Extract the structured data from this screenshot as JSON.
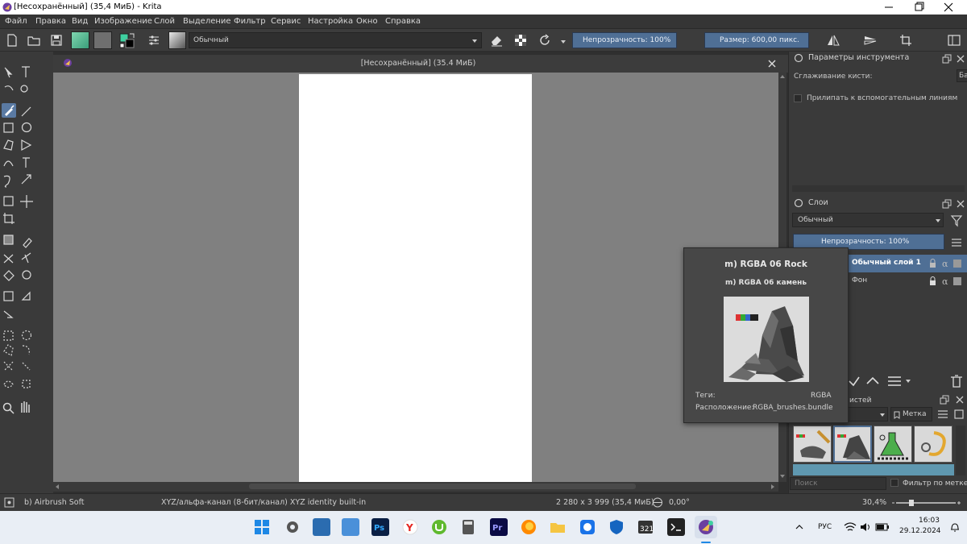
{
  "window": {
    "title": "[Несохранённый]  (35,4 МиБ)  - Krita"
  },
  "menu": [
    "Файл",
    "Правка",
    "Вид",
    "Изображение",
    "Слой",
    "Выделение",
    "Фильтр",
    "Сервис",
    "Настройка",
    "Окно",
    "Справка"
  ],
  "toolbar": {
    "blend_mode": "Обычный",
    "opacity_label": "Непрозрачность: 100%",
    "size_label": "Размер: 600,00 пикс."
  },
  "document": {
    "tab_title": "[Несохранённый]  (35.4 МиБ)"
  },
  "tool_options": {
    "header": "Параметры инструмента",
    "smoothing_label": "Сглаживание кисти:",
    "smoothing_value": "Ба",
    "snap_label": "Прилипать к вспомогательным линиям"
  },
  "layers": {
    "header": "Слои",
    "blend_mode": "Обычный",
    "opacity_label": "Непрозрачность:  100%",
    "items": [
      {
        "name": "Обычный слой 1",
        "selected": true
      },
      {
        "name": "Фон",
        "selected": false
      }
    ]
  },
  "brush_presets": {
    "header_partial": "истей",
    "tag_label": "Метка",
    "search_placeholder": "Поиск",
    "filter_label": "Фильтр по метке"
  },
  "tooltip": {
    "title": "m) RGBA 06 Rock",
    "subtitle": "m) RGBA 06 камень",
    "tags_label": "Теги:",
    "tags_value": "RGBA",
    "location_label": "Расположение:",
    "location_value": "RGBA_brushes.bundle"
  },
  "status": {
    "brush": "b) Airbrush Soft",
    "color_space": "XYZ/альфа-канал (8-бит/канал)  XYZ identity built-in",
    "dimensions": "2 280 x 3 999 (35,4 МиБ)",
    "rotation": "0,00°",
    "zoom": "30,4%"
  },
  "taskbar": {
    "lang": "РУС",
    "time": "16:03",
    "date": "29.12.2024"
  },
  "colors": {
    "accent_blue": "#4f6f95",
    "selected_layer": "#4f6f95",
    "canvas_bg": "#808080",
    "paper": "#ffffff"
  }
}
